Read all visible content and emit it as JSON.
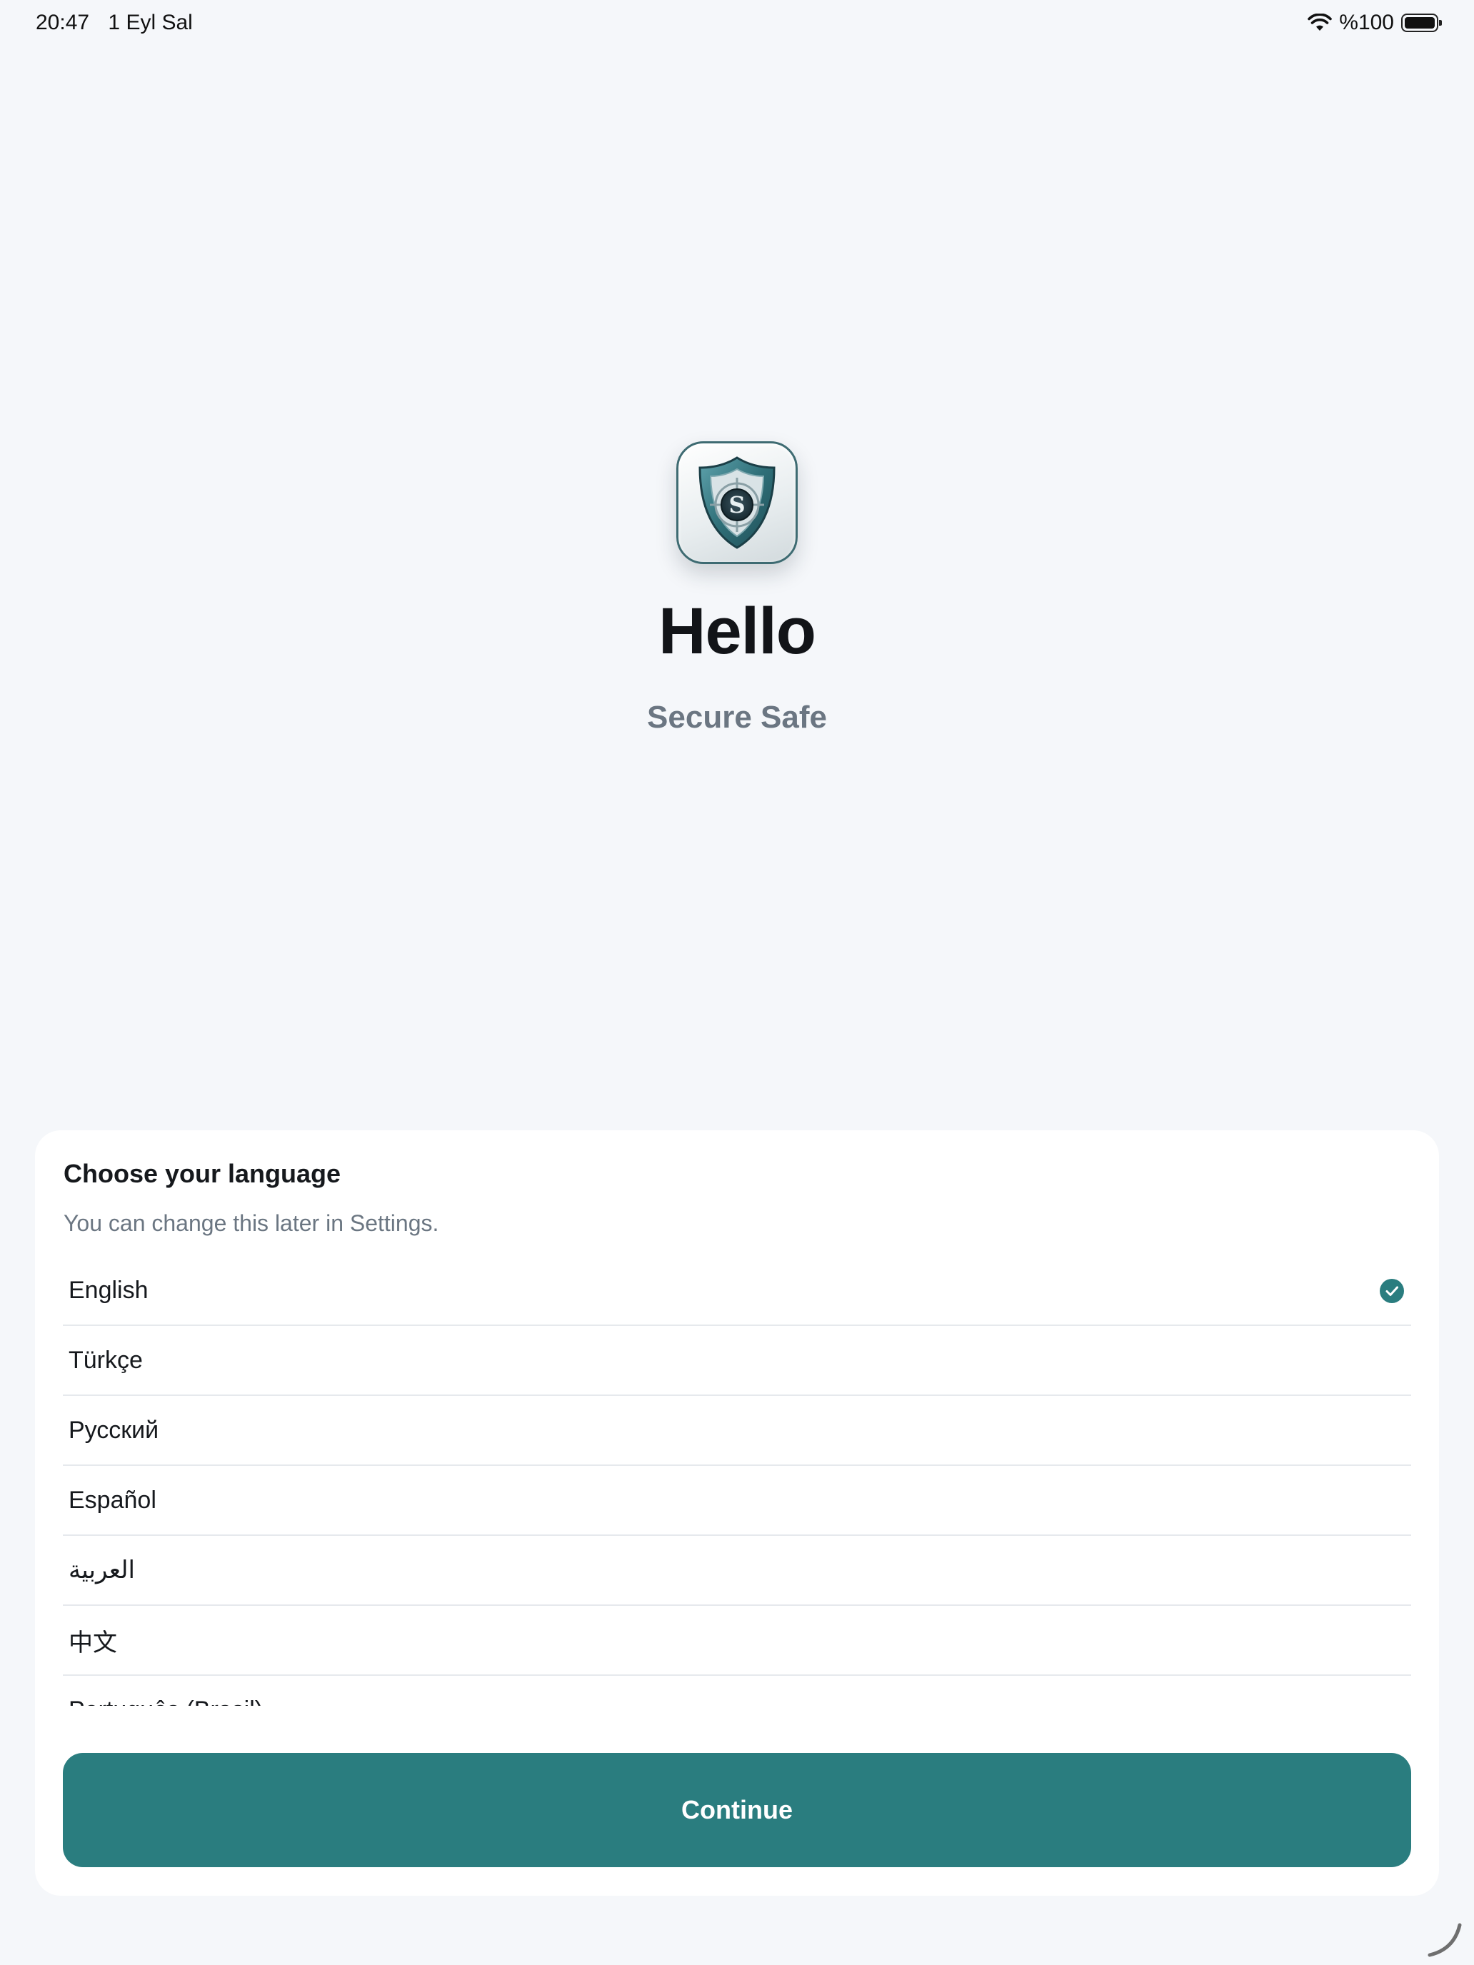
{
  "status_bar": {
    "time": "20:47",
    "date": "1 Eyl Sal",
    "battery_percent": "%100",
    "wifi_icon": "wifi-icon",
    "battery_icon": "battery-icon"
  },
  "hero": {
    "app_icon": "shield-s-app-icon",
    "title": "Hello",
    "subtitle": "Secure Safe"
  },
  "language_card": {
    "title": "Choose your language",
    "hint": "You can change this later in Settings.",
    "languages": [
      {
        "label": "English",
        "selected": true
      },
      {
        "label": "Türkçe",
        "selected": false
      },
      {
        "label": "Русский",
        "selected": false
      },
      {
        "label": "Español",
        "selected": false
      },
      {
        "label": "العربية",
        "selected": false
      },
      {
        "label": "中文",
        "selected": false
      },
      {
        "label": "Português (Brasil)",
        "selected": false
      }
    ],
    "continue_label": "Continue"
  },
  "colors": {
    "accent": "#2a7d7f",
    "background": "#f5f7fa",
    "card": "#ffffff",
    "muted_text": "#6b7682"
  }
}
